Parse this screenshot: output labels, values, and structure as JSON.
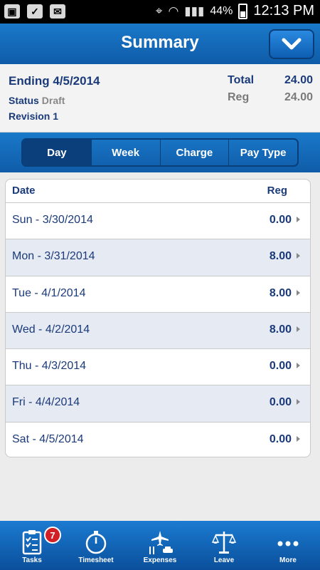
{
  "status_bar": {
    "battery": "44%",
    "time": "12:13 PM"
  },
  "header": {
    "title": "Summary"
  },
  "summary": {
    "ending": "Ending 4/5/2014",
    "status_label": "Status",
    "status_value": "Draft",
    "revision": "Revision 1",
    "total_label": "Total",
    "total_value": "24.00",
    "reg_label": "Reg",
    "reg_value": "24.00"
  },
  "tabs": [
    {
      "label": "Day",
      "selected": true
    },
    {
      "label": "Week"
    },
    {
      "label": "Charge"
    },
    {
      "label": "Pay Type"
    }
  ],
  "table": {
    "col_date": "Date",
    "col_reg": "Reg",
    "rows": [
      {
        "date": "Sun - 3/30/2014",
        "reg": "0.00"
      },
      {
        "date": "Mon - 3/31/2014",
        "reg": "8.00"
      },
      {
        "date": "Tue - 4/1/2014",
        "reg": "8.00"
      },
      {
        "date": "Wed - 4/2/2014",
        "reg": "8.00"
      },
      {
        "date": "Thu - 4/3/2014",
        "reg": "0.00"
      },
      {
        "date": "Fri - 4/4/2014",
        "reg": "0.00"
      },
      {
        "date": "Sat - 4/5/2014",
        "reg": "0.00"
      }
    ]
  },
  "bottom_nav": {
    "tasks": "Tasks",
    "tasks_badge": "7",
    "timesheet": "Timesheet",
    "expenses": "Expenses",
    "leave": "Leave",
    "more": "More"
  },
  "colors": {
    "header_blue": "#1a79c9",
    "text_navy": "#1a3a7a",
    "badge_red": "#d21f25"
  }
}
